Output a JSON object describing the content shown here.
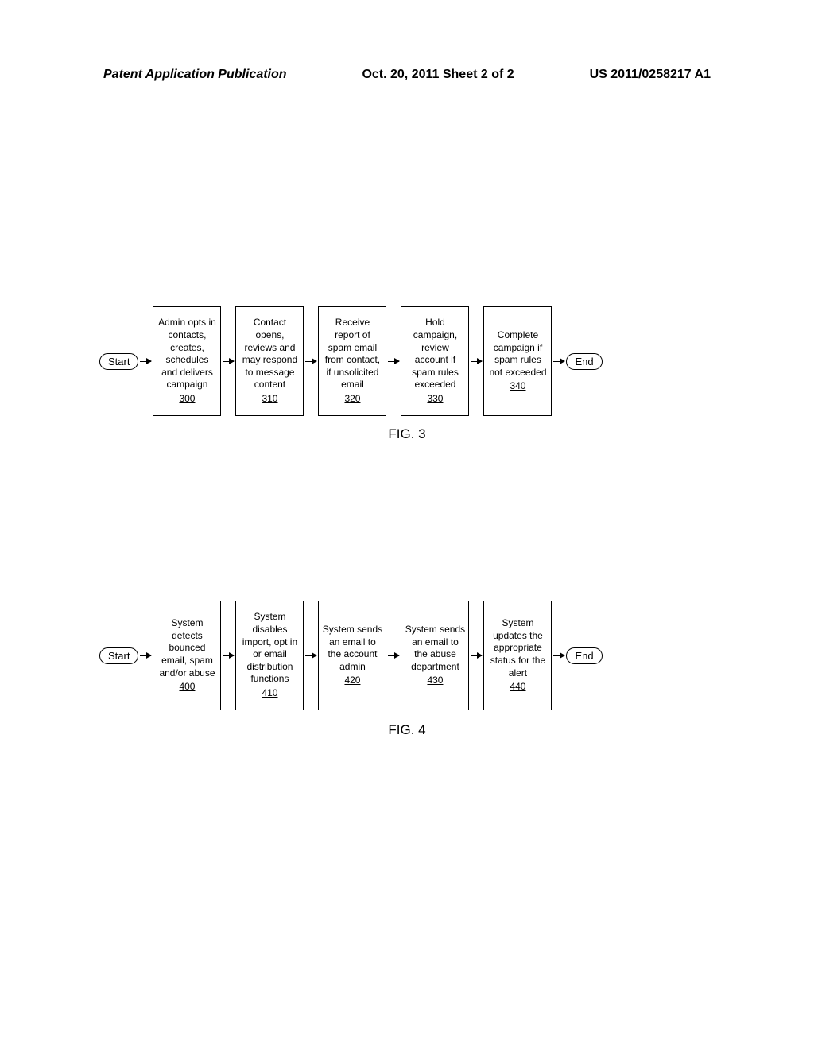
{
  "header": {
    "left": "Patent Application Publication",
    "center": "Oct. 20, 2011  Sheet 2 of 2",
    "right": "US 2011/0258217 A1"
  },
  "fig3": {
    "start": "Start",
    "end": "End",
    "label": "FIG. 3",
    "boxes": [
      {
        "text": "Admin opts in contacts, creates, schedules and delivers campaign",
        "ref": "300"
      },
      {
        "text": "Contact opens, reviews and may respond to message content",
        "ref": "310"
      },
      {
        "text": "Receive report of spam email from contact, if unsolicited email",
        "ref": "320"
      },
      {
        "text": "Hold campaign, review account if spam rules exceeded",
        "ref": "330"
      },
      {
        "text": "Complete campaign if spam rules not exceeded",
        "ref": "340"
      }
    ]
  },
  "fig4": {
    "start": "Start",
    "end": "End",
    "label": "FIG. 4",
    "boxes": [
      {
        "text": "System detects bounced email, spam and/or abuse",
        "ref": "400"
      },
      {
        "text": "System disables import, opt in or email distribution functions",
        "ref": "410"
      },
      {
        "text": "System sends an email to the account admin",
        "ref": "420"
      },
      {
        "text": "System sends an email to the abuse department",
        "ref": "430"
      },
      {
        "text": "System updates the appropriate status for the alert",
        "ref": "440"
      }
    ]
  },
  "chart_data": [
    {
      "type": "flowchart",
      "title": "FIG. 3",
      "nodes": [
        {
          "id": "start3",
          "shape": "terminator",
          "label": "Start"
        },
        {
          "id": "300",
          "shape": "process",
          "label": "Admin opts in contacts, creates, schedules and delivers campaign",
          "ref": "300"
        },
        {
          "id": "310",
          "shape": "process",
          "label": "Contact opens, reviews and may respond to message content",
          "ref": "310"
        },
        {
          "id": "320",
          "shape": "process",
          "label": "Receive report of spam email from contact, if unsolicited email",
          "ref": "320"
        },
        {
          "id": "330",
          "shape": "process",
          "label": "Hold campaign, review account if spam rules exceeded",
          "ref": "330"
        },
        {
          "id": "340",
          "shape": "process",
          "label": "Complete campaign if spam rules not exceeded",
          "ref": "340"
        },
        {
          "id": "end3",
          "shape": "terminator",
          "label": "End"
        }
      ],
      "edges": [
        [
          "start3",
          "300"
        ],
        [
          "300",
          "310"
        ],
        [
          "310",
          "320"
        ],
        [
          "320",
          "330"
        ],
        [
          "330",
          "340"
        ],
        [
          "340",
          "end3"
        ]
      ]
    },
    {
      "type": "flowchart",
      "title": "FIG. 4",
      "nodes": [
        {
          "id": "start4",
          "shape": "terminator",
          "label": "Start"
        },
        {
          "id": "400",
          "shape": "process",
          "label": "System detects bounced email, spam and/or abuse",
          "ref": "400"
        },
        {
          "id": "410",
          "shape": "process",
          "label": "System disables import, opt in or email distribution functions",
          "ref": "410"
        },
        {
          "id": "420",
          "shape": "process",
          "label": "System sends an email to the account admin",
          "ref": "420"
        },
        {
          "id": "430",
          "shape": "process",
          "label": "System sends an email to the abuse department",
          "ref": "430"
        },
        {
          "id": "440",
          "shape": "process",
          "label": "System updates the appropriate status for the alert",
          "ref": "440"
        },
        {
          "id": "end4",
          "shape": "terminator",
          "label": "End"
        }
      ],
      "edges": [
        [
          "start4",
          "400"
        ],
        [
          "400",
          "410"
        ],
        [
          "410",
          "420"
        ],
        [
          "420",
          "430"
        ],
        [
          "430",
          "440"
        ],
        [
          "440",
          "end4"
        ]
      ]
    }
  ]
}
